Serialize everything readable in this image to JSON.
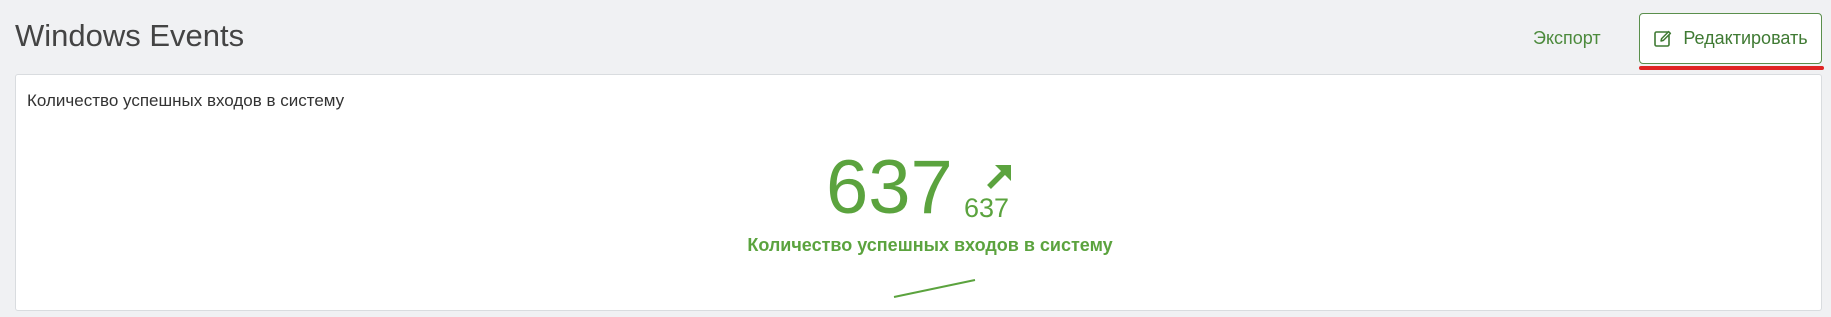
{
  "header": {
    "title": "Windows Events",
    "export_label": "Экспорт",
    "edit_label": "Редактировать",
    "edit_icon": "edit-icon"
  },
  "widget": {
    "title": "Количество успешных входов в систему",
    "metric": {
      "value": "637",
      "trend_value": "637",
      "trend_direction": "up",
      "trend_icon": "arrow-up-right-icon",
      "caption": "Количество успешных входов в систему"
    }
  },
  "colors": {
    "accent": "#5ba33e",
    "button_text": "#3f7a33",
    "button_border": "#5a8f4c",
    "highlight": "#e02424",
    "background": "#f0f1f3"
  }
}
